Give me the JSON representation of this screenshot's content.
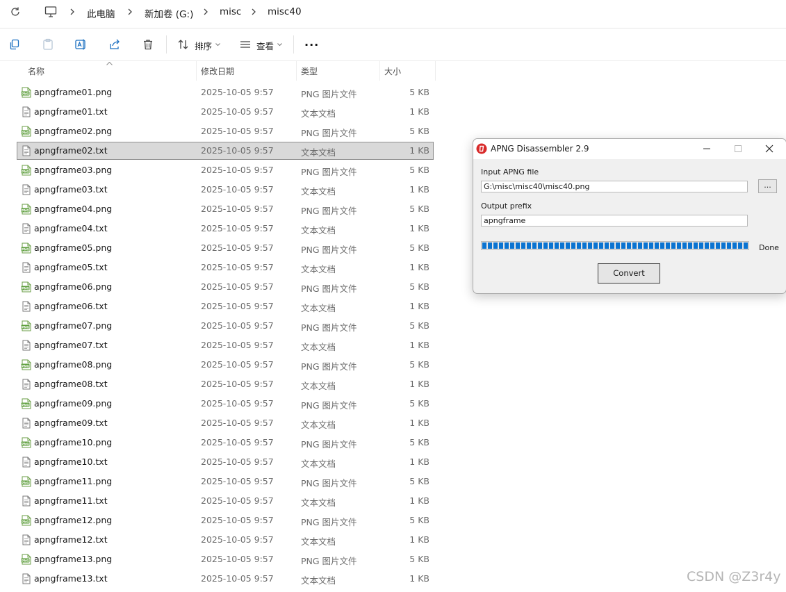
{
  "address_bar": {
    "breadcrumb": [
      "此电脑",
      "新加卷 (G:)",
      "misc",
      "misc40"
    ]
  },
  "toolbar": {
    "sort_label": "排序",
    "view_label": "查看",
    "more_label": "..."
  },
  "columns": [
    "名称",
    "修改日期",
    "类型",
    "大小"
  ],
  "files": [
    {
      "name": "apngframe01.png",
      "date": "2025-10-05 9:57",
      "type": "PNG 图片文件",
      "size": "5 KB",
      "icon": "png-file-icon"
    },
    {
      "name": "apngframe01.txt",
      "date": "2025-10-05 9:57",
      "type": "文本文档",
      "size": "1 KB",
      "icon": "text-file-icon"
    },
    {
      "name": "apngframe02.png",
      "date": "2025-10-05 9:57",
      "type": "PNG 图片文件",
      "size": "5 KB",
      "icon": "png-file-icon"
    },
    {
      "name": "apngframe02.txt",
      "date": "2025-10-05 9:57",
      "type": "文本文档",
      "size": "1 KB",
      "icon": "text-file-icon",
      "selected": true
    },
    {
      "name": "apngframe03.png",
      "date": "2025-10-05 9:57",
      "type": "PNG 图片文件",
      "size": "5 KB",
      "icon": "png-file-icon"
    },
    {
      "name": "apngframe03.txt",
      "date": "2025-10-05 9:57",
      "type": "文本文档",
      "size": "1 KB",
      "icon": "text-file-icon"
    },
    {
      "name": "apngframe04.png",
      "date": "2025-10-05 9:57",
      "type": "PNG 图片文件",
      "size": "5 KB",
      "icon": "png-file-icon"
    },
    {
      "name": "apngframe04.txt",
      "date": "2025-10-05 9:57",
      "type": "文本文档",
      "size": "1 KB",
      "icon": "text-file-icon"
    },
    {
      "name": "apngframe05.png",
      "date": "2025-10-05 9:57",
      "type": "PNG 图片文件",
      "size": "5 KB",
      "icon": "png-file-icon"
    },
    {
      "name": "apngframe05.txt",
      "date": "2025-10-05 9:57",
      "type": "文本文档",
      "size": "1 KB",
      "icon": "text-file-icon"
    },
    {
      "name": "apngframe06.png",
      "date": "2025-10-05 9:57",
      "type": "PNG 图片文件",
      "size": "5 KB",
      "icon": "png-file-icon"
    },
    {
      "name": "apngframe06.txt",
      "date": "2025-10-05 9:57",
      "type": "文本文档",
      "size": "1 KB",
      "icon": "text-file-icon"
    },
    {
      "name": "apngframe07.png",
      "date": "2025-10-05 9:57",
      "type": "PNG 图片文件",
      "size": "5 KB",
      "icon": "png-file-icon"
    },
    {
      "name": "apngframe07.txt",
      "date": "2025-10-05 9:57",
      "type": "文本文档",
      "size": "1 KB",
      "icon": "text-file-icon"
    },
    {
      "name": "apngframe08.png",
      "date": "2025-10-05 9:57",
      "type": "PNG 图片文件",
      "size": "5 KB",
      "icon": "png-file-icon"
    },
    {
      "name": "apngframe08.txt",
      "date": "2025-10-05 9:57",
      "type": "文本文档",
      "size": "1 KB",
      "icon": "text-file-icon"
    },
    {
      "name": "apngframe09.png",
      "date": "2025-10-05 9:57",
      "type": "PNG 图片文件",
      "size": "5 KB",
      "icon": "png-file-icon"
    },
    {
      "name": "apngframe09.txt",
      "date": "2025-10-05 9:57",
      "type": "文本文档",
      "size": "1 KB",
      "icon": "text-file-icon"
    },
    {
      "name": "apngframe10.png",
      "date": "2025-10-05 9:57",
      "type": "PNG 图片文件",
      "size": "5 KB",
      "icon": "png-file-icon"
    },
    {
      "name": "apngframe10.txt",
      "date": "2025-10-05 9:57",
      "type": "文本文档",
      "size": "1 KB",
      "icon": "text-file-icon"
    },
    {
      "name": "apngframe11.png",
      "date": "2025-10-05 9:57",
      "type": "PNG 图片文件",
      "size": "5 KB",
      "icon": "png-file-icon"
    },
    {
      "name": "apngframe11.txt",
      "date": "2025-10-05 9:57",
      "type": "文本文档",
      "size": "1 KB",
      "icon": "text-file-icon"
    },
    {
      "name": "apngframe12.png",
      "date": "2025-10-05 9:57",
      "type": "PNG 图片文件",
      "size": "5 KB",
      "icon": "png-file-icon"
    },
    {
      "name": "apngframe12.txt",
      "date": "2025-10-05 9:57",
      "type": "文本文档",
      "size": "1 KB",
      "icon": "text-file-icon"
    },
    {
      "name": "apngframe13.png",
      "date": "2025-10-05 9:57",
      "type": "PNG 图片文件",
      "size": "5 KB",
      "icon": "png-file-icon"
    },
    {
      "name": "apngframe13.txt",
      "date": "2025-10-05 9:57",
      "type": "文本文档",
      "size": "1 KB",
      "icon": "text-file-icon"
    }
  ],
  "dialog": {
    "title": "APNG Disassembler 2.9",
    "input_label": "Input APNG file",
    "input_value": "G:\\misc\\misc40\\misc40.png",
    "browse_label": "...",
    "output_label": "Output prefix",
    "output_value": "apngframe",
    "progress_percent": 100,
    "status": "Done",
    "convert_label": "Convert"
  },
  "watermark": "CSDN @Z3r4y",
  "colors": {
    "selection": "#d9d9d9",
    "progress": "#0a73d1",
    "png_icon": "#5c9e3b"
  }
}
